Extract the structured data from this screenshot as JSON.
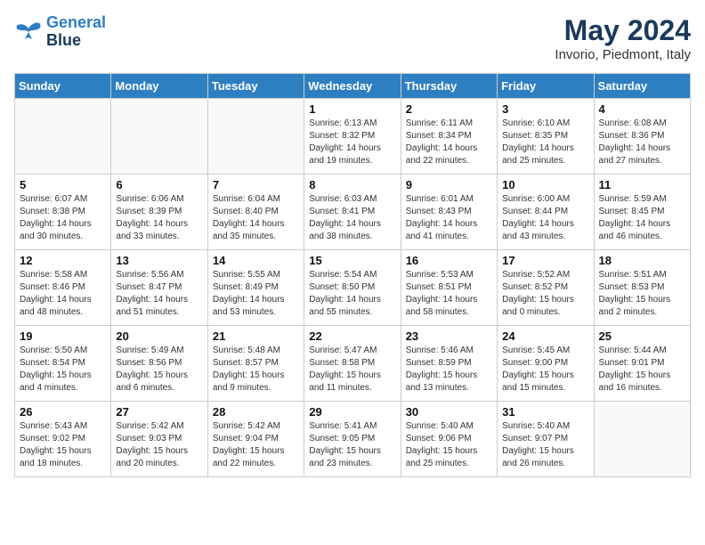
{
  "header": {
    "logo": {
      "line1": "General",
      "line2": "Blue"
    },
    "title": "May 2024",
    "subtitle": "Invorio, Piedmont, Italy"
  },
  "days_of_week": [
    "Sunday",
    "Monday",
    "Tuesday",
    "Wednesday",
    "Thursday",
    "Friday",
    "Saturday"
  ],
  "weeks": [
    [
      {
        "day": "",
        "info": ""
      },
      {
        "day": "",
        "info": ""
      },
      {
        "day": "",
        "info": ""
      },
      {
        "day": "1",
        "info": "Sunrise: 6:13 AM\nSunset: 8:32 PM\nDaylight: 14 hours\nand 19 minutes."
      },
      {
        "day": "2",
        "info": "Sunrise: 6:11 AM\nSunset: 8:34 PM\nDaylight: 14 hours\nand 22 minutes."
      },
      {
        "day": "3",
        "info": "Sunrise: 6:10 AM\nSunset: 8:35 PM\nDaylight: 14 hours\nand 25 minutes."
      },
      {
        "day": "4",
        "info": "Sunrise: 6:08 AM\nSunset: 8:36 PM\nDaylight: 14 hours\nand 27 minutes."
      }
    ],
    [
      {
        "day": "5",
        "info": "Sunrise: 6:07 AM\nSunset: 8:38 PM\nDaylight: 14 hours\nand 30 minutes."
      },
      {
        "day": "6",
        "info": "Sunrise: 6:06 AM\nSunset: 8:39 PM\nDaylight: 14 hours\nand 33 minutes."
      },
      {
        "day": "7",
        "info": "Sunrise: 6:04 AM\nSunset: 8:40 PM\nDaylight: 14 hours\nand 35 minutes."
      },
      {
        "day": "8",
        "info": "Sunrise: 6:03 AM\nSunset: 8:41 PM\nDaylight: 14 hours\nand 38 minutes."
      },
      {
        "day": "9",
        "info": "Sunrise: 6:01 AM\nSunset: 8:43 PM\nDaylight: 14 hours\nand 41 minutes."
      },
      {
        "day": "10",
        "info": "Sunrise: 6:00 AM\nSunset: 8:44 PM\nDaylight: 14 hours\nand 43 minutes."
      },
      {
        "day": "11",
        "info": "Sunrise: 5:59 AM\nSunset: 8:45 PM\nDaylight: 14 hours\nand 46 minutes."
      }
    ],
    [
      {
        "day": "12",
        "info": "Sunrise: 5:58 AM\nSunset: 8:46 PM\nDaylight: 14 hours\nand 48 minutes."
      },
      {
        "day": "13",
        "info": "Sunrise: 5:56 AM\nSunset: 8:47 PM\nDaylight: 14 hours\nand 51 minutes."
      },
      {
        "day": "14",
        "info": "Sunrise: 5:55 AM\nSunset: 8:49 PM\nDaylight: 14 hours\nand 53 minutes."
      },
      {
        "day": "15",
        "info": "Sunrise: 5:54 AM\nSunset: 8:50 PM\nDaylight: 14 hours\nand 55 minutes."
      },
      {
        "day": "16",
        "info": "Sunrise: 5:53 AM\nSunset: 8:51 PM\nDaylight: 14 hours\nand 58 minutes."
      },
      {
        "day": "17",
        "info": "Sunrise: 5:52 AM\nSunset: 8:52 PM\nDaylight: 15 hours\nand 0 minutes."
      },
      {
        "day": "18",
        "info": "Sunrise: 5:51 AM\nSunset: 8:53 PM\nDaylight: 15 hours\nand 2 minutes."
      }
    ],
    [
      {
        "day": "19",
        "info": "Sunrise: 5:50 AM\nSunset: 8:54 PM\nDaylight: 15 hours\nand 4 minutes."
      },
      {
        "day": "20",
        "info": "Sunrise: 5:49 AM\nSunset: 8:56 PM\nDaylight: 15 hours\nand 6 minutes."
      },
      {
        "day": "21",
        "info": "Sunrise: 5:48 AM\nSunset: 8:57 PM\nDaylight: 15 hours\nand 9 minutes."
      },
      {
        "day": "22",
        "info": "Sunrise: 5:47 AM\nSunset: 8:58 PM\nDaylight: 15 hours\nand 11 minutes."
      },
      {
        "day": "23",
        "info": "Sunrise: 5:46 AM\nSunset: 8:59 PM\nDaylight: 15 hours\nand 13 minutes."
      },
      {
        "day": "24",
        "info": "Sunrise: 5:45 AM\nSunset: 9:00 PM\nDaylight: 15 hours\nand 15 minutes."
      },
      {
        "day": "25",
        "info": "Sunrise: 5:44 AM\nSunset: 9:01 PM\nDaylight: 15 hours\nand 16 minutes."
      }
    ],
    [
      {
        "day": "26",
        "info": "Sunrise: 5:43 AM\nSunset: 9:02 PM\nDaylight: 15 hours\nand 18 minutes."
      },
      {
        "day": "27",
        "info": "Sunrise: 5:42 AM\nSunset: 9:03 PM\nDaylight: 15 hours\nand 20 minutes."
      },
      {
        "day": "28",
        "info": "Sunrise: 5:42 AM\nSunset: 9:04 PM\nDaylight: 15 hours\nand 22 minutes."
      },
      {
        "day": "29",
        "info": "Sunrise: 5:41 AM\nSunset: 9:05 PM\nDaylight: 15 hours\nand 23 minutes."
      },
      {
        "day": "30",
        "info": "Sunrise: 5:40 AM\nSunset: 9:06 PM\nDaylight: 15 hours\nand 25 minutes."
      },
      {
        "day": "31",
        "info": "Sunrise: 5:40 AM\nSunset: 9:07 PM\nDaylight: 15 hours\nand 26 minutes."
      },
      {
        "day": "",
        "info": ""
      }
    ]
  ]
}
